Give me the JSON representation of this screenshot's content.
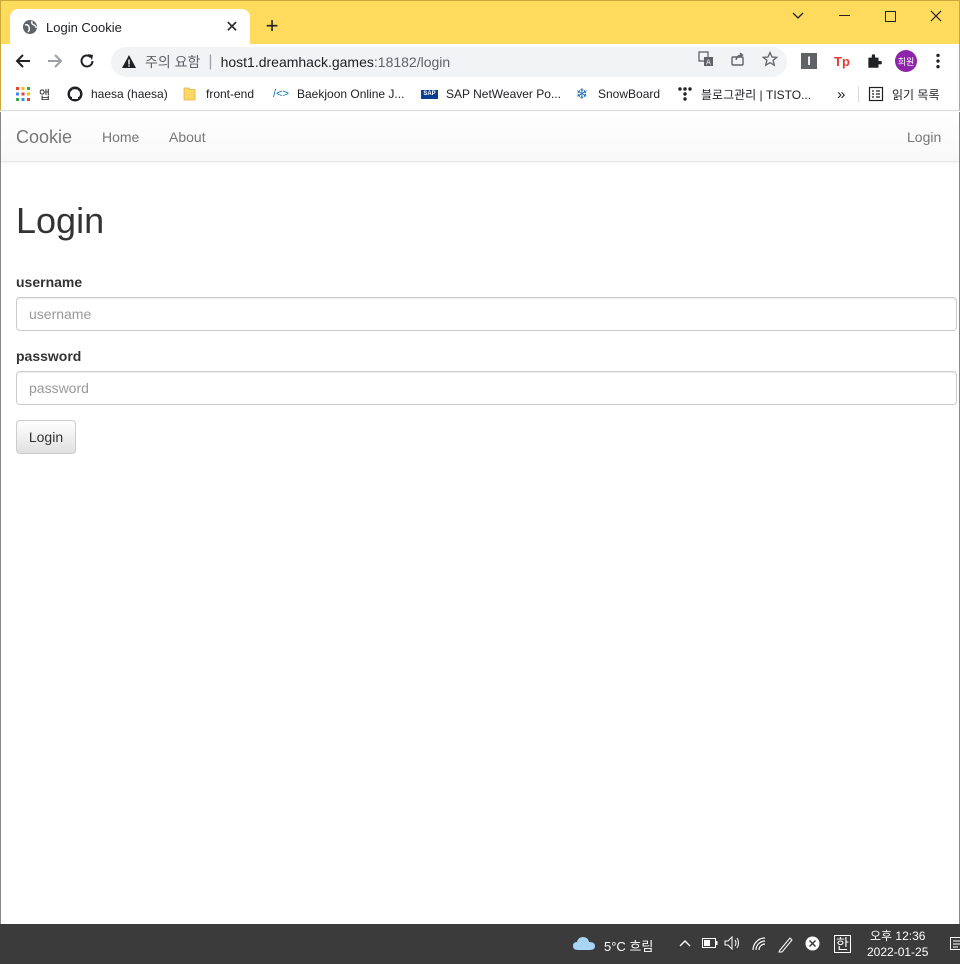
{
  "browser": {
    "tab_title": "Login Cookie",
    "tab_close": "✕",
    "new_tab": "+",
    "security_text": "주의 요함",
    "url_separator": "|",
    "url_host": "host1.dreamhack.games",
    "url_path": ":18182/login",
    "profile_initials": "희원",
    "extension_label": "I"
  },
  "bookmarks": [
    {
      "label": "앱",
      "icon": "apps-grid-icon"
    },
    {
      "label": "haesa (haesa)",
      "icon": "github-icon"
    },
    {
      "label": "front-end",
      "icon": "folder-icon"
    },
    {
      "label": "Baekjoon Online J...",
      "icon": "code-icon"
    },
    {
      "label": "SAP NetWeaver Po...",
      "icon": "sap-icon"
    },
    {
      "label": "SnowBoard",
      "icon": "snowflake-icon"
    },
    {
      "label": "블로그관리 | TISTO...",
      "icon": "tistory-icon"
    },
    {
      "label": "»",
      "icon": "more-icon"
    },
    {
      "label": "읽기 목록",
      "icon": "reading-list-icon"
    }
  ],
  "navbar": {
    "brand": "Cookie",
    "links": [
      "Home",
      "About"
    ],
    "right_link": "Login"
  },
  "page": {
    "title": "Login",
    "username_label": "username",
    "username_placeholder": "username",
    "password_label": "password",
    "password_placeholder": "password",
    "submit_label": "Login"
  },
  "taskbar": {
    "weather": "5°C  흐림",
    "ime": "한",
    "time": "오후 12:36",
    "date": "2022-01-25"
  },
  "colors": {
    "titlebar": "#fedb5c",
    "taskbar": "#3b3b3b",
    "profile": "#8e24aa"
  }
}
